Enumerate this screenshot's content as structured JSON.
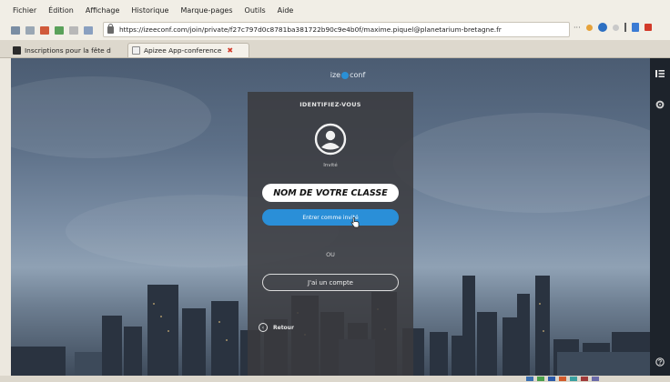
{
  "menu": [
    "Fichier",
    "Édition",
    "Affichage",
    "Historique",
    "Marque-pages",
    "Outils",
    "Aide"
  ],
  "address": {
    "url": "https://izeeconf.com/join/private/f27c797d0c8781ba381722b90c9e4b0f/maxime.piquel@planetarium-bretagne.fr",
    "overflow": "···"
  },
  "tabs": [
    {
      "label": "Inscriptions pour la fête d"
    },
    {
      "label": "Apizee App-conference",
      "close": "✖"
    }
  ],
  "app": {
    "logo_text": "izeeconf",
    "logo_prefix": "ize",
    "logo_suffix": "conf"
  },
  "dialog": {
    "title": "IDENTIFIEZ-VOUS",
    "guest_label": "Invité",
    "class_input_value": "NOM DE VOTRE CLASSE",
    "guest_button": "Entrer comme invité",
    "or": "OU",
    "account_button": "J'ai un compte",
    "back_label": "Retour"
  },
  "colors": {
    "accent": "#2a8fd8",
    "dialog_bg": "#3a3a3e",
    "sidebar": "#1d232b"
  }
}
